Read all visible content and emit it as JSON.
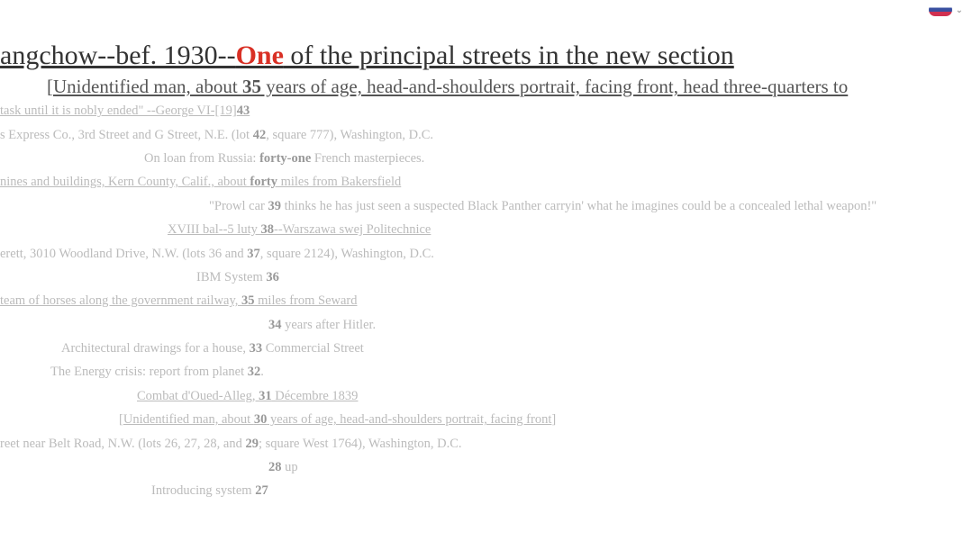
{
  "topnav": {
    "flag_label": "language-flag",
    "chevron": "⌄"
  },
  "title": {
    "pre": "angchow--bef. 1930--",
    "highlight": "One",
    "post": " of the principal streets in the new section"
  },
  "sub1": {
    "bracket_open": "[",
    "text_a": "Unidentified man, about ",
    "num": "35",
    "text_b": " years of age, head-and-shoulders portrait, facing front, head three-quarters to"
  },
  "rows": {
    "r1": {
      "a": " task until it is nobly ended\" --George VI-[19]",
      "num": "43"
    },
    "r2": {
      "a": "s Express Co., 3rd Street and G Street, N.E. (lot ",
      "num": "42",
      "b": ", square 777), Washington, D.C."
    },
    "r3": {
      "a": "On loan from Russia: ",
      "num": "forty-one",
      "b": " French masterpieces."
    },
    "r4": {
      "a": "nines and buildings, Kern County, Calif., about ",
      "num": "forty",
      "b": " miles from Bakersfield"
    },
    "r5": {
      "a": "\"Prowl car ",
      "num": "39",
      "b": " thinks he has just seen a suspected Black Panther carryin' what he imagines could be a concealed lethal weapon!\""
    },
    "r6": {
      "a": "XVIII bal--5 luty ",
      "num": "38",
      "b": "--Warszawa swej Politechnice"
    },
    "r7": {
      "a": "erett, 3010 Woodland Drive, N.W. (lots 36 and ",
      "num": "37",
      "b": ", square 2124), Washington, D.C."
    },
    "r8": {
      "a": "IBM System ",
      "num": "36"
    },
    "r9": {
      "a": "team of horses along the government railway, ",
      "num": "35",
      "b": " miles from Seward"
    },
    "r10": {
      "num": "34",
      "b": " years after Hitler."
    },
    "r11": {
      "a": "Architectural drawings for a house, ",
      "num": "33",
      "b": " Commercial Street"
    },
    "r12": {
      "a": "The Energy crisis: report from planet ",
      "num": "32",
      "b": "."
    },
    "r13": {
      "a": "Combat d'Oued-Alleg, ",
      "num": "31",
      "b": " Décembre 1839"
    },
    "r14": {
      "bracket_open": "[",
      "a": "Unidentified man, about ",
      "num": "30",
      "b": " years of age, head-and-shoulders portrait, facing front",
      "bracket_close": "]"
    },
    "r15": {
      "a": "reet near Belt Road, N.W. (lots 26, 27, 28, and ",
      "num": "29",
      "b": "; square West 1764), Washington, D.C."
    },
    "r16": {
      "num": "28",
      "b": " up"
    },
    "r17": {
      "a": "Introducing system ",
      "num": "27"
    }
  }
}
